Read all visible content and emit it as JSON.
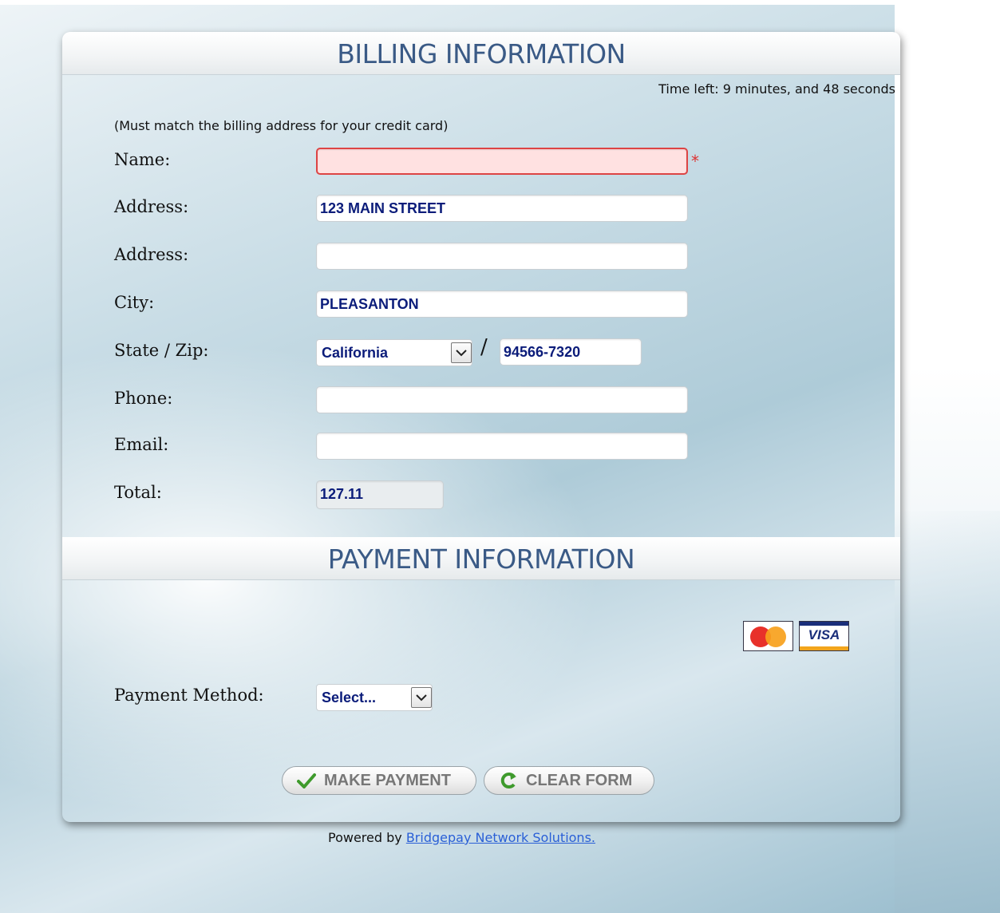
{
  "billing": {
    "title": "BILLING INFORMATION",
    "timer": "Time left: 9 minutes, and 48 seconds",
    "note": "(Must match the billing address for your credit card)",
    "required_mark": "*",
    "fields": {
      "name": {
        "label": "Name:",
        "value": ""
      },
      "address1": {
        "label": "Address:",
        "value": "123 MAIN STREET"
      },
      "address2": {
        "label": "Address:",
        "value": ""
      },
      "city": {
        "label": "City:",
        "value": "PLEASANTON"
      },
      "state_zip": {
        "label": "State / Zip:",
        "state": "California",
        "separator": "/",
        "zip": "94566-7320"
      },
      "phone": {
        "label": "Phone:",
        "value": ""
      },
      "email": {
        "label": "Email:",
        "value": ""
      },
      "total": {
        "label": "Total:",
        "value": "127.11"
      }
    }
  },
  "payment": {
    "title": "PAYMENT INFORMATION",
    "cards": [
      "MasterCard",
      "VISA"
    ],
    "method": {
      "label": "Payment Method:",
      "selected": "Select..."
    },
    "buttons": {
      "make_payment": "MAKE PAYMENT",
      "clear_form": "CLEAR FORM"
    }
  },
  "footer": {
    "powered_prefix": "Powered by",
    "powered_link": "Bridgepay Network Solutions."
  },
  "colors": {
    "header_text": "#3a5a86",
    "field_text": "#0b1c7a",
    "error_bg": "#ffe1e1",
    "error_border": "#dd4444",
    "link": "#2a5fd6"
  }
}
